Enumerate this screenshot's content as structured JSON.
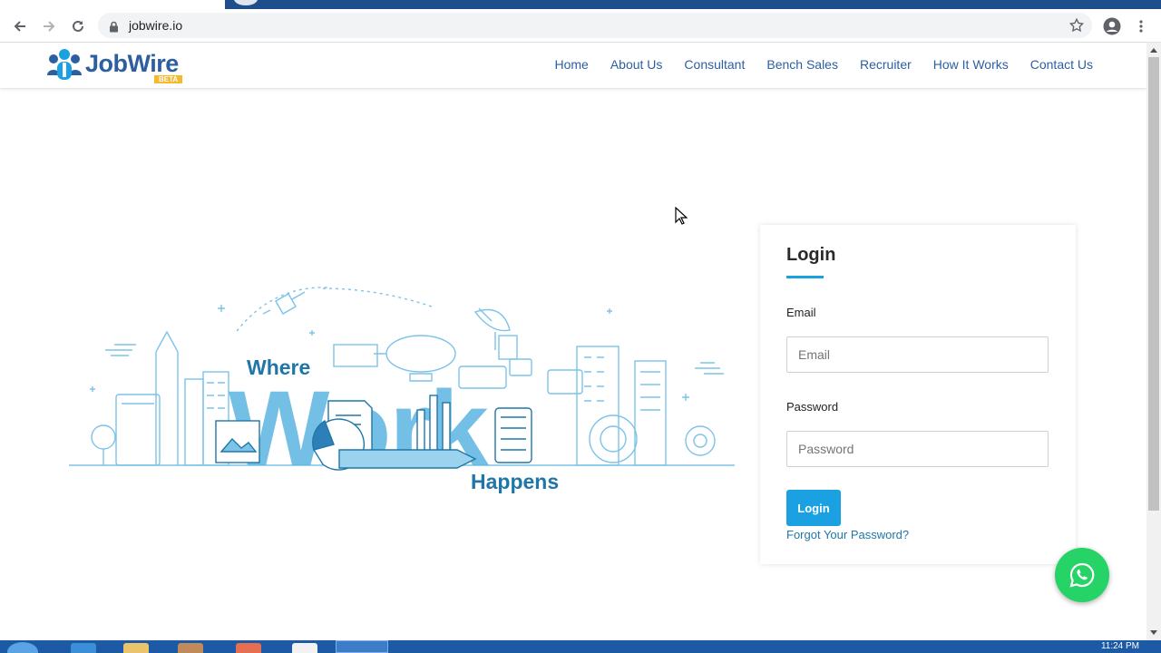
{
  "browser": {
    "url": "jobwire.io",
    "icons": [
      "back-icon",
      "forward-icon",
      "reload-icon",
      "lock-icon",
      "bookmark-star-icon",
      "profile-icon",
      "menu-dots-icon"
    ]
  },
  "site": {
    "logo_text": "JobWire",
    "logo_badge": "BETA",
    "nav": [
      {
        "label": "Home"
      },
      {
        "label": "About Us"
      },
      {
        "label": "Consultant"
      },
      {
        "label": "Bench Sales"
      },
      {
        "label": "Recruiter"
      },
      {
        "label": "How It Works"
      },
      {
        "label": "Contact Us"
      }
    ]
  },
  "hero": {
    "word_top": "Where",
    "word_main": "Work",
    "word_bottom": "Happens"
  },
  "login": {
    "title": "Login",
    "email_label": "Email",
    "email_placeholder": "Email",
    "email_value": "",
    "password_label": "Password",
    "password_placeholder": "Password",
    "password_value": "",
    "button_label": "Login",
    "forgot_label": "Forgot Your Password?"
  },
  "taskbar": {
    "clock": "11:24 PM"
  },
  "colors": {
    "brand_blue": "#2d5fa0",
    "accent": "#1ba1e2",
    "illustration": "#5ab4e0",
    "whatsapp": "#25d366"
  }
}
